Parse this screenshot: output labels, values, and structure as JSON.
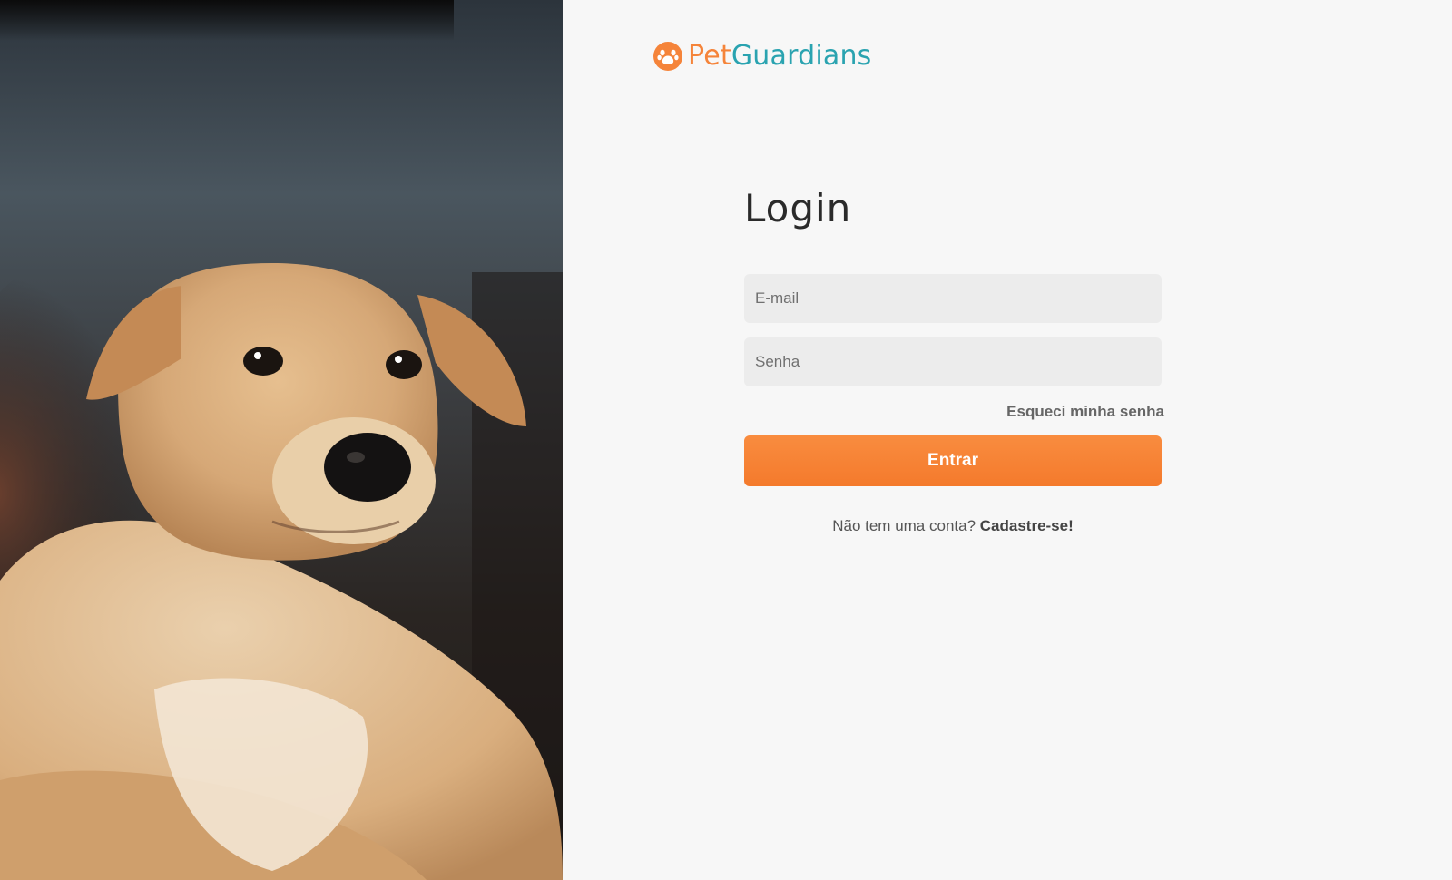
{
  "brand": {
    "name_part1": "Pet",
    "name_part2": "Guardians",
    "icon": "paw-icon",
    "colors": {
      "orange": "#f5843a",
      "teal": "#2aa3b0"
    }
  },
  "hero": {
    "image": "dog-photo"
  },
  "login": {
    "title": "Login",
    "email_placeholder": "E-mail",
    "password_placeholder": "Senha",
    "forgot_password": "Esqueci minha senha",
    "submit_label": "Entrar",
    "signup_prompt": "Não tem uma conta?",
    "signup_link": "Cadastre-se!"
  },
  "colors": {
    "button": "#f47a2c",
    "background": "#f7f7f7",
    "field": "#ececec"
  }
}
